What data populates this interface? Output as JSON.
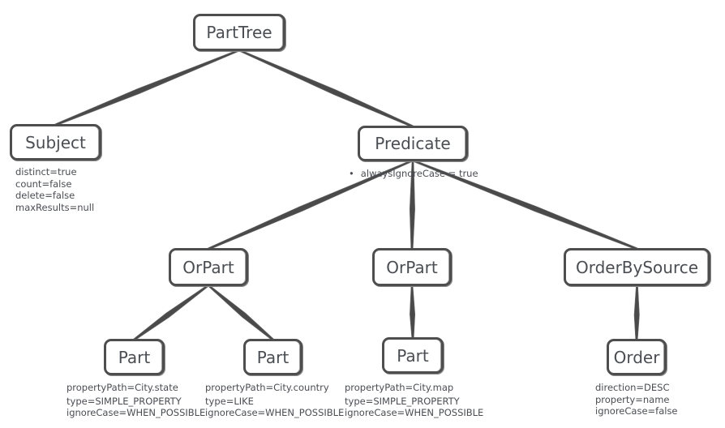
{
  "diagram": {
    "type": "tree",
    "nodes": {
      "parttree": {
        "label": "PartTree"
      },
      "subject": {
        "label": "Subject",
        "props": [
          "distinct=true",
          "count=false",
          "delete=false",
          "maxResults=null"
        ]
      },
      "predicate": {
        "label": "Predicate",
        "props": [
          "alwaysIgnoreCase = true"
        ]
      },
      "orpart1": {
        "label": "OrPart"
      },
      "orpart2": {
        "label": "OrPart"
      },
      "orderbysource": {
        "label": "OrderBySource"
      },
      "part1": {
        "label": "Part",
        "props": [
          "propertyPath=City.state",
          "type=SIMPLE_PROPERTY",
          "ignoreCase=WHEN_POSSIBLE"
        ]
      },
      "part2": {
        "label": "Part",
        "props": [
          "propertyPath=City.country",
          "type=LIKE",
          "ignoreCase=WHEN_POSSIBLE"
        ]
      },
      "part3": {
        "label": "Part",
        "props": [
          "propertyPath=City.map",
          "type=SIMPLE_PROPERTY",
          "ignoreCase=WHEN_POSSIBLE"
        ]
      },
      "order": {
        "label": "Order",
        "props": [
          "direction=DESC",
          "property=name",
          "ignoreCase=false"
        ]
      }
    },
    "edges": [
      [
        "parttree",
        "subject"
      ],
      [
        "parttree",
        "predicate"
      ],
      [
        "predicate",
        "orpart1"
      ],
      [
        "predicate",
        "orpart2"
      ],
      [
        "predicate",
        "orderbysource"
      ],
      [
        "orpart1",
        "part1"
      ],
      [
        "orpart1",
        "part2"
      ],
      [
        "orpart2",
        "part3"
      ],
      [
        "orderbysource",
        "order"
      ]
    ]
  }
}
